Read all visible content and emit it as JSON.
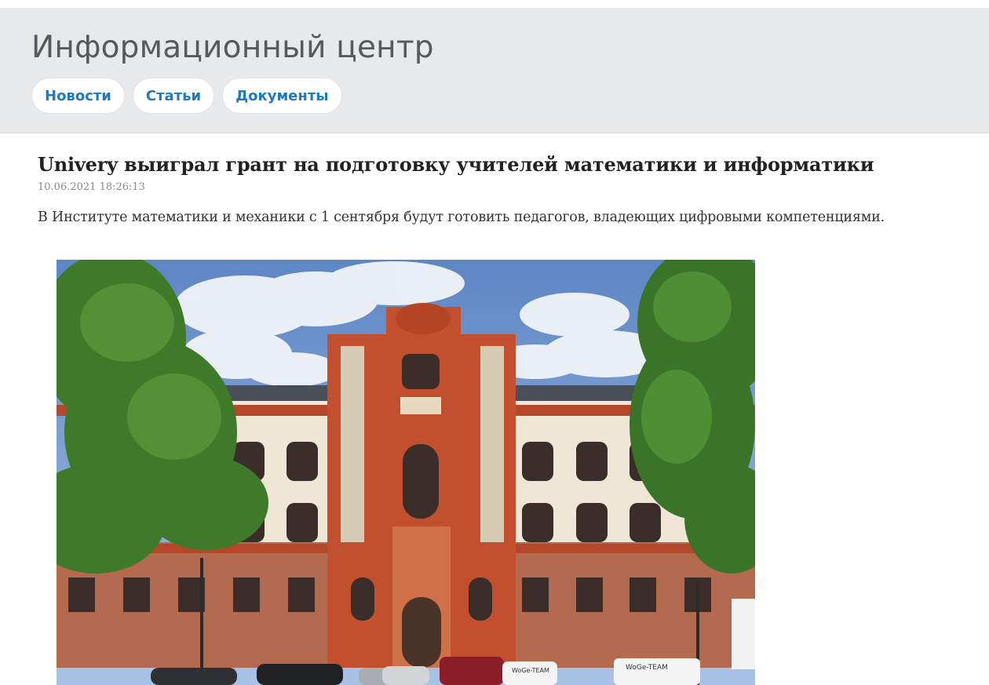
{
  "header": {
    "title": "Информационный центр",
    "nav": [
      {
        "label": "Новости"
      },
      {
        "label": "Статьи"
      },
      {
        "label": "Документы"
      }
    ]
  },
  "article": {
    "title": "Univery выиграл грант на подготовку учителей математики и информатики",
    "date": "10.06.2021 18:26:13",
    "lead": "В Институте математики и механики с 1 сентября будут готовить педагогов, владеющих цифровыми компетенциями.",
    "image": {
      "van_label": "WoGe-TEAM"
    }
  },
  "colors": {
    "accent": "#1f7ac4",
    "header_bg": "#e8e9eb"
  }
}
